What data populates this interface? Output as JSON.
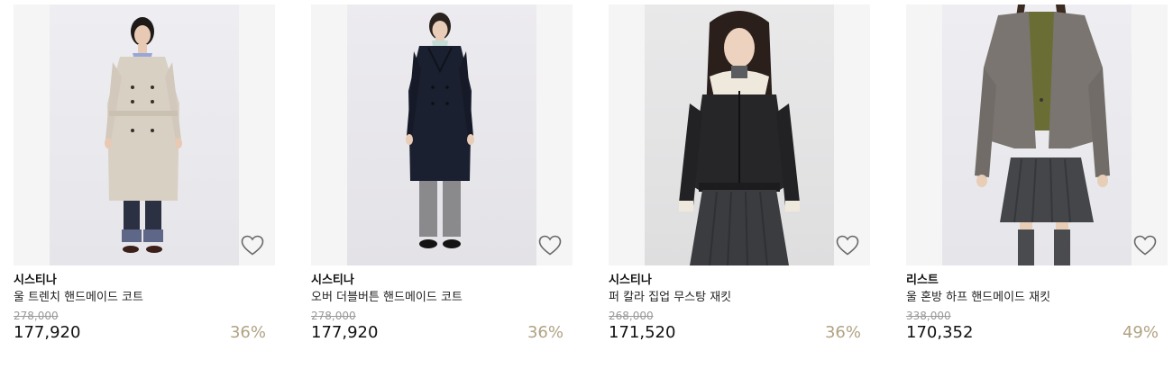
{
  "colors": {
    "discount": "#b1a283",
    "thumb_bg": "#f5f5f5",
    "text": "#111111",
    "strike": "#999999"
  },
  "products": [
    {
      "brand": "시스티나",
      "name": "울 트렌치 핸드메이드 코트",
      "original_price": "278,000",
      "price": "177,920",
      "discount": "36%",
      "wishlist_icon": "heart-outline-icon"
    },
    {
      "brand": "시스티나",
      "name": "오버 더블버튼 핸드메이드 코트",
      "original_price": "278,000",
      "price": "177,920",
      "discount": "36%",
      "wishlist_icon": "heart-outline-icon"
    },
    {
      "brand": "시스티나",
      "name": "퍼 칼라 집업 무스탕 재킷",
      "original_price": "268,000",
      "price": "171,520",
      "discount": "36%",
      "wishlist_icon": "heart-outline-icon"
    },
    {
      "brand": "리스트",
      "name": "울 혼방 하프 핸드메이드 재킷",
      "original_price": "338,000",
      "price": "170,352",
      "discount": "49%",
      "wishlist_icon": "heart-outline-icon"
    }
  ]
}
